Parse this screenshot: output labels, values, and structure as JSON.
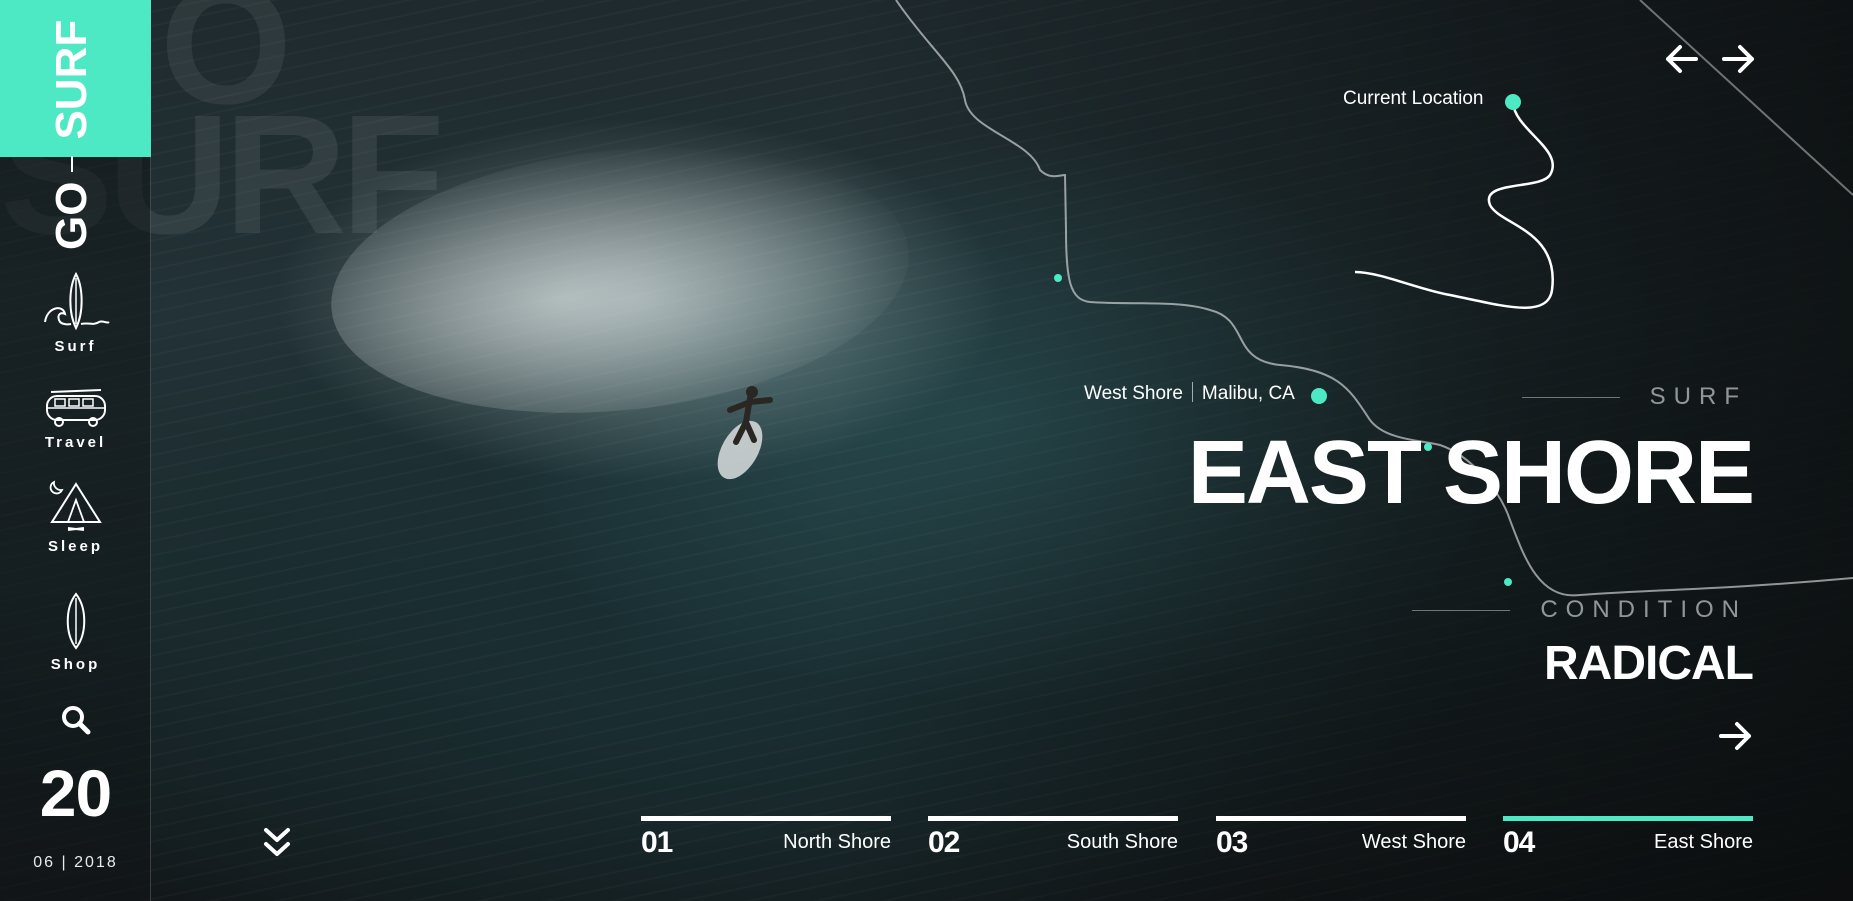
{
  "brand": {
    "go": "GO",
    "surf": "SURF",
    "accent_color": "#4de8c4"
  },
  "watermark": {
    "text": "SURF",
    "top_text": "O"
  },
  "sidebar": {
    "items": [
      {
        "label": "Surf",
        "icon": "surfboard-wave-icon"
      },
      {
        "label": "Travel",
        "icon": "van-icon"
      },
      {
        "label": "Sleep",
        "icon": "tent-icon"
      },
      {
        "label": "Shop",
        "icon": "surfboard-icon"
      }
    ],
    "search_icon": "search-icon"
  },
  "date": {
    "day": "20",
    "month": "06",
    "year": "2018",
    "separator": "|"
  },
  "nav": {
    "prev_icon": "arrow-left-icon",
    "next_icon": "arrow-right-icon"
  },
  "map": {
    "current_location": "Current Location",
    "spot_name": "West Shore",
    "spot_place": "Malibu, CA"
  },
  "hero": {
    "eyebrow": "SURF",
    "title": "EAST SHORE",
    "condition_label": "CONDITION",
    "condition_value": "RADICAL"
  },
  "tabs": [
    {
      "num": "01",
      "name": "North Shore",
      "active": false
    },
    {
      "num": "02",
      "name": "South Shore",
      "active": false
    },
    {
      "num": "03",
      "name": "West Shore",
      "active": false
    },
    {
      "num": "04",
      "name": "East Shore",
      "active": true
    }
  ]
}
